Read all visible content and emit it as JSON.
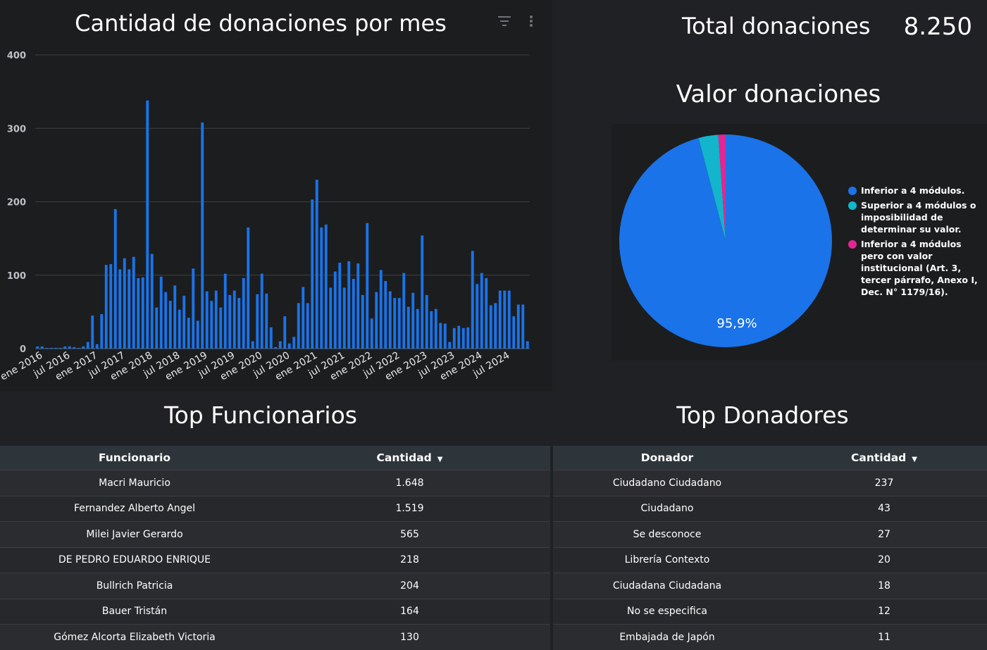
{
  "bar_chart": {
    "title": "Cantidad de donaciones por mes",
    "filter_icon": "filter-icon",
    "more_icon": "more-vert-icon"
  },
  "total": {
    "label": "Total donaciones",
    "value": "8.250"
  },
  "pie_chart": {
    "title": "Valor donaciones"
  },
  "top_funcionarios": {
    "title": "Top Funcionarios",
    "headers": [
      "Funcionario",
      "Cantidad"
    ],
    "rows": [
      [
        "Macri Mauricio",
        "1.648"
      ],
      [
        "Fernandez Alberto Angel",
        "1.519"
      ],
      [
        "Milei Javier Gerardo",
        "565"
      ],
      [
        "DE PEDRO EDUARDO ENRIQUE",
        "218"
      ],
      [
        "Bullrich Patricia",
        "204"
      ],
      [
        "Bauer Tristán",
        "164"
      ],
      [
        "Gómez Alcorta Elizabeth Victoria",
        "130"
      ]
    ]
  },
  "top_donadores": {
    "title": "Top Donadores",
    "headers": [
      "Donador",
      "Cantidad"
    ],
    "rows": [
      [
        "Ciudadano Ciudadano",
        "237"
      ],
      [
        "Ciudadano",
        "43"
      ],
      [
        "Se desconoce",
        "27"
      ],
      [
        "Librería Contexto",
        "20"
      ],
      [
        "Ciudadana Ciudadana",
        "18"
      ],
      [
        "No se especifica",
        "12"
      ],
      [
        "Embajada de Japón",
        "11"
      ]
    ]
  },
  "chart_data": [
    {
      "type": "bar",
      "title": "Cantidad de donaciones por mes",
      "ylim": [
        0,
        400
      ],
      "yticks": [
        0,
        100,
        200,
        300,
        400
      ],
      "xtick_labels": [
        "ene 2016",
        "jul 2016",
        "ene 2017",
        "jul 2017",
        "ene 2018",
        "jul 2018",
        "ene 2019",
        "jul 2019",
        "ene 2020",
        "jul 2020",
        "ene 2021",
        "jul 2021",
        "ene 2022",
        "jul 2022",
        "ene 2023",
        "jul 2023",
        "ene 2024",
        "jul 2024"
      ],
      "xtick_every": 6,
      "color": "#1a73e8",
      "values": [
        3,
        3,
        1,
        1,
        1,
        1,
        3,
        3,
        2,
        1,
        3,
        9,
        45,
        6,
        47,
        114,
        115,
        190,
        108,
        123,
        108,
        125,
        96,
        97,
        338,
        129,
        56,
        98,
        77,
        65,
        86,
        53,
        72,
        42,
        109,
        38,
        308,
        78,
        65,
        79,
        56,
        102,
        73,
        79,
        69,
        96,
        165,
        10,
        74,
        102,
        75,
        29,
        2,
        10,
        44,
        7,
        16,
        62,
        84,
        62,
        203,
        230,
        165,
        169,
        83,
        105,
        117,
        83,
        119,
        95,
        116,
        73,
        171,
        41,
        77,
        107,
        92,
        78,
        69,
        69,
        103,
        57,
        76,
        54,
        154,
        73,
        51,
        54,
        35,
        34,
        9,
        28,
        31,
        28,
        29,
        133,
        88,
        103,
        96,
        59,
        62,
        79,
        79,
        79,
        44,
        60,
        60,
        10
      ]
    },
    {
      "type": "pie",
      "title": "Valor donaciones",
      "slices": [
        {
          "label": "Inferior a 4 módulos.",
          "value": 95.9,
          "color": "#1a73e8",
          "data_label": "95,9%"
        },
        {
          "label": "Superior a 4 módulos o imposibilidad de determinar su valor.",
          "value": 3.0,
          "color": "#12b5cb"
        },
        {
          "label": "Inferior a 4 módulos pero con valor institucional (Art. 3, tercer párrafo, Anexo I, Dec. N° 1179/16).",
          "value": 1.1,
          "color": "#e52592"
        }
      ],
      "legend_position": "right"
    }
  ]
}
